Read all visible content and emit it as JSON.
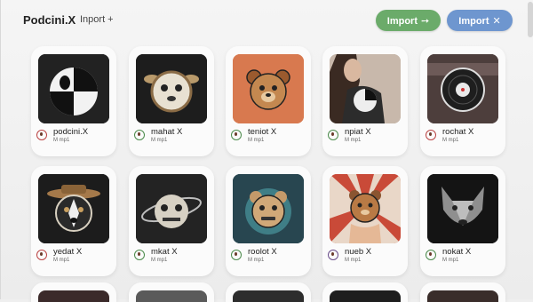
{
  "header": {
    "app_title": "Podcini.X",
    "import_link": "Inport +",
    "import_btn_green": "Import",
    "import_btn_green_icon": "➙",
    "import_btn_blue": "Import",
    "import_btn_blue_icon": "✕"
  },
  "colors": {
    "green_button": "#6bab6a",
    "blue_button": "#6e96cf",
    "background": "#efefef"
  },
  "cards": [
    {
      "name": "podcini.X",
      "sub": "M mp1",
      "icon": "panda-ball-icon",
      "status": "red"
    },
    {
      "name": "mahat X",
      "sub": "M mp1",
      "icon": "bear-icon",
      "status": "green"
    },
    {
      "name": "teniot X",
      "sub": "M mp1",
      "icon": "bear-orange-icon",
      "status": "green"
    },
    {
      "name": "npiat X",
      "sub": "M mp1",
      "icon": "photo-person-icon",
      "status": "green"
    },
    {
      "name": "rochat X",
      "sub": "M mp1",
      "icon": "vinyl-record-icon",
      "status": "red"
    },
    {
      "name": "yedat X",
      "sub": "M mp1",
      "icon": "dog-hat-icon",
      "status": "red"
    },
    {
      "name": "mkat X",
      "sub": "M mp1",
      "icon": "cat-skull-icon",
      "status": "green"
    },
    {
      "name": "roolot X",
      "sub": "M mp1",
      "icon": "bear-teal-icon",
      "status": "green"
    },
    {
      "name": "nueb X",
      "sub": "M mp1",
      "icon": "bear-hand-icon",
      "status": "purple"
    },
    {
      "name": "nokat X",
      "sub": "M mp1",
      "icon": "wolf-face-icon",
      "status": "green"
    }
  ]
}
